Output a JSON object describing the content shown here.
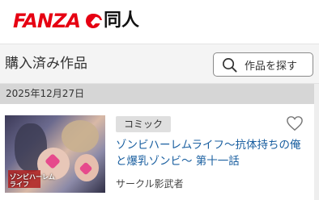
{
  "header": {
    "brand": "FANZA",
    "section": "同人"
  },
  "titlebar": {
    "title": "購入済み作品",
    "search_label": "作品を探す"
  },
  "list": {
    "date": "2025年12月27日",
    "items": [
      {
        "category": "コミック",
        "title": "ゾンビハーレムライフ～抗体持ちの俺と爆乳ゾンビ～ 第十一話",
        "circle": "サークル影武者",
        "thumbnail_text": "ゾンビハーレムライフ"
      }
    ]
  },
  "colors": {
    "brand_red": "#e60012",
    "link_blue": "#1a5fa0",
    "date_bar": "#d6d6d6"
  }
}
